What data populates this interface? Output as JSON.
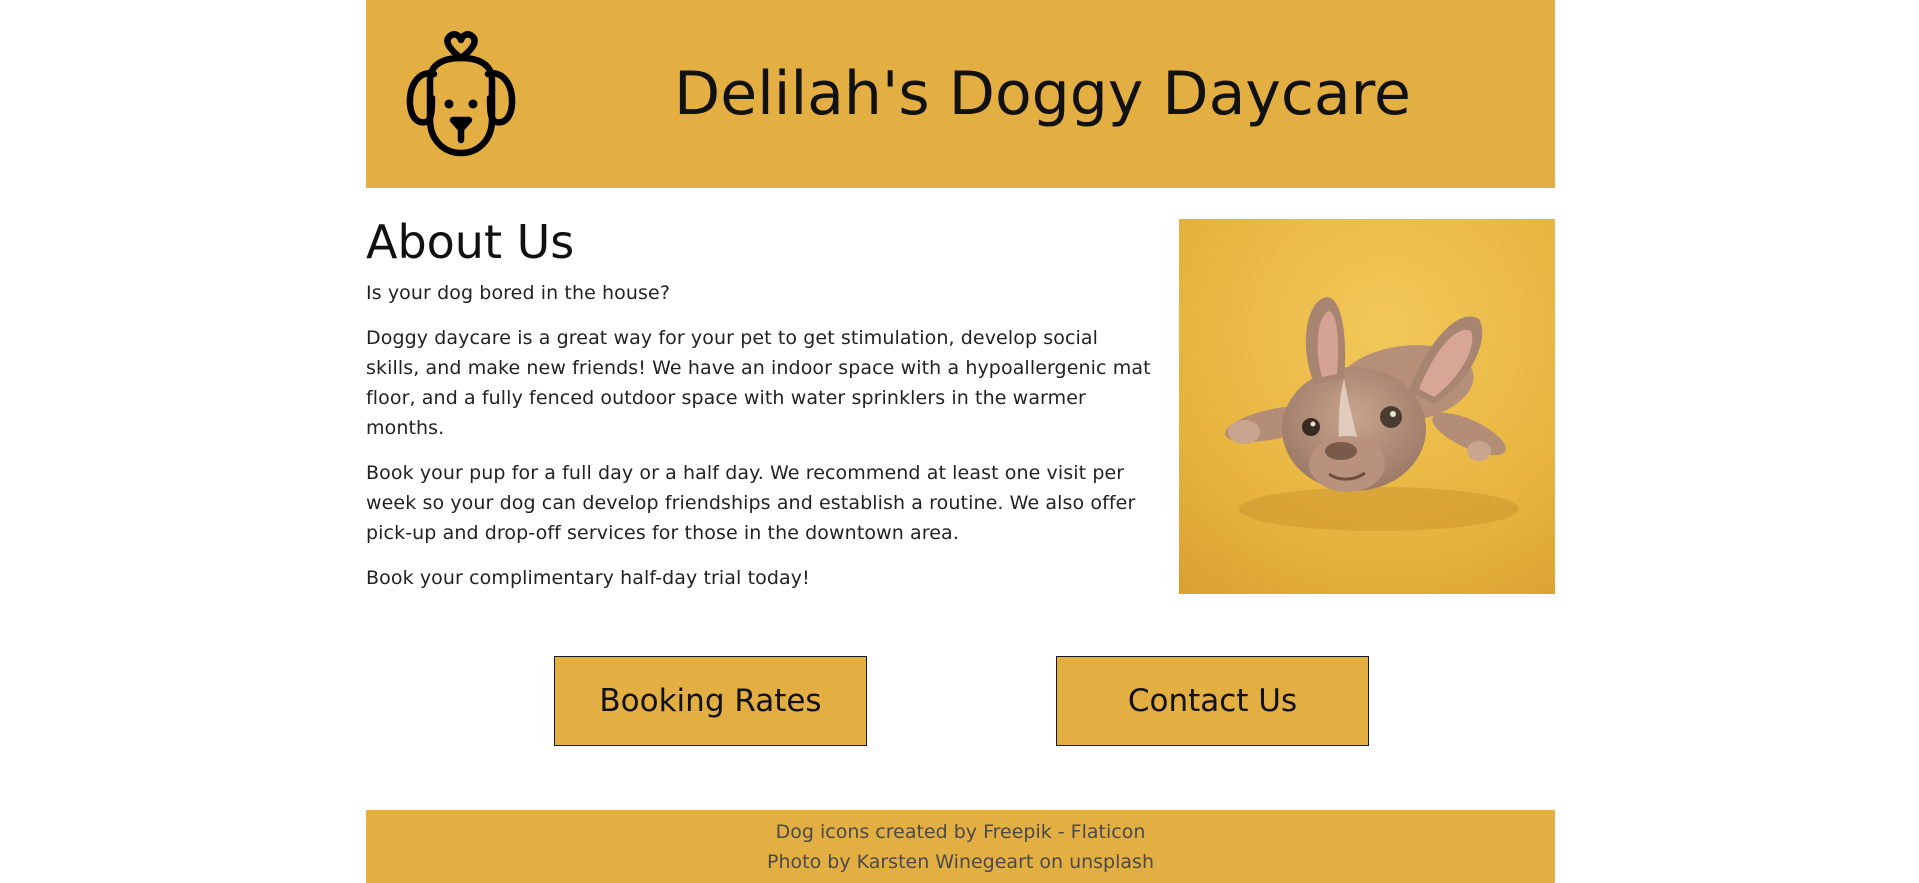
{
  "header": {
    "title": "Delilah's Doggy Daycare",
    "logo_icon": "dog-heart-icon"
  },
  "about": {
    "heading": "About Us",
    "paragraphs": [
      "Is your dog bored in the house?",
      "Doggy daycare is a great way for your pet to get stimulation, develop social skills, and make new friends! We have an indoor space with a hypoallergenic mat floor, and a fully fenced outdoor space with water sprinklers in the warmer months.",
      "Book your pup for a full day or a half day. We recommend at least one visit per week so your dog can develop friendships and establish a routine. We also offer pick-up and drop-off services for those in the downtown area.",
      "Book your complimentary half-day trial today!"
    ],
    "photo": "french-bulldog-puppy-on-yellow-background"
  },
  "buttons": {
    "booking_label": "Booking Rates",
    "contact_label": "Contact Us"
  },
  "footer": {
    "credits": [
      "Dog icons created by Freepik - Flaticon",
      "Photo by Karsten Winegeart on unsplash"
    ]
  },
  "colors": {
    "accent": "#e4af42",
    "background": "#ffffff",
    "text": "#1f1f1f"
  }
}
